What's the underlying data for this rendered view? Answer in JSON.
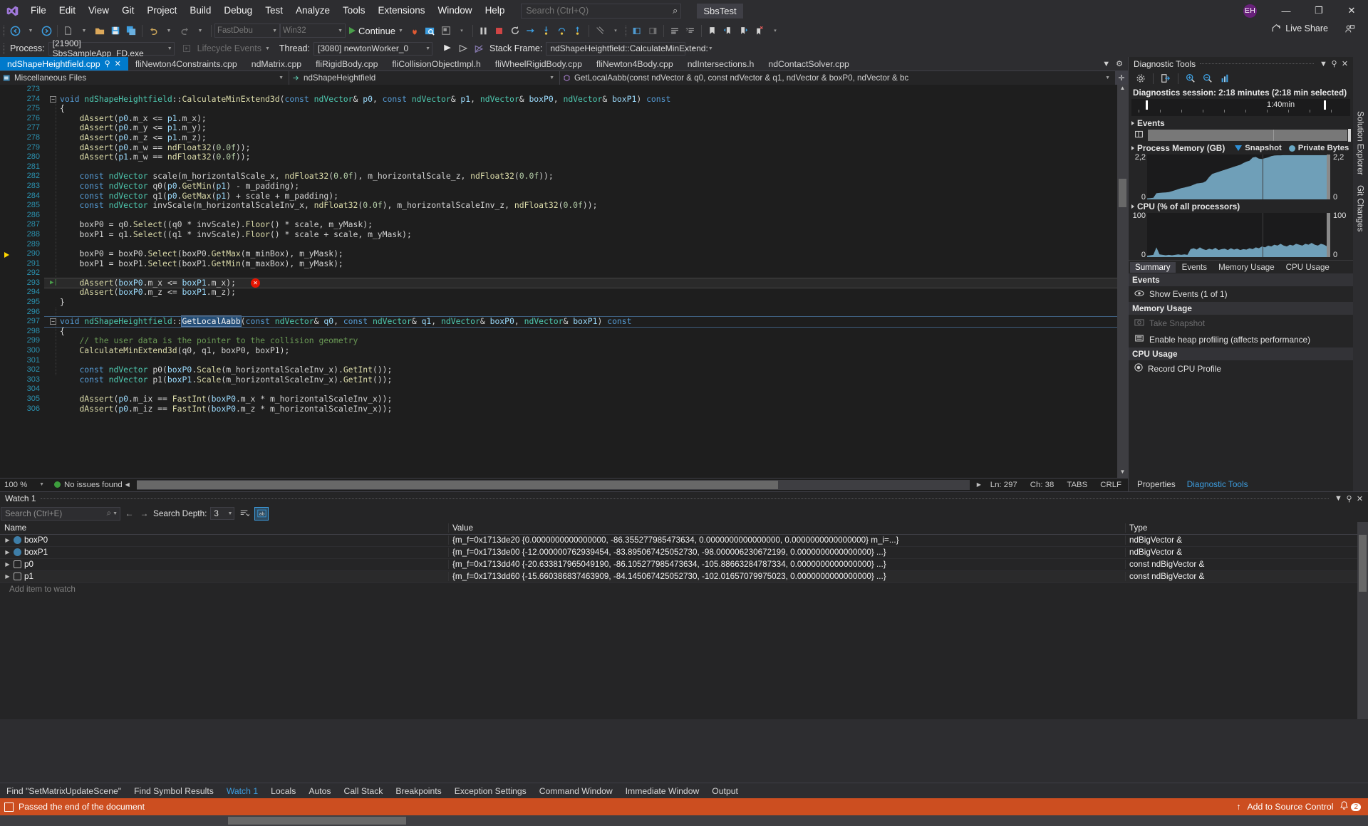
{
  "window": {
    "solution_name": "SbsTest",
    "avatar_initials": "EH",
    "minimize": "—",
    "maximize": "❐",
    "close": "✕"
  },
  "menu": {
    "items": [
      "File",
      "Edit",
      "View",
      "Git",
      "Project",
      "Build",
      "Debug",
      "Test",
      "Analyze",
      "Tools",
      "Extensions",
      "Window",
      "Help"
    ]
  },
  "search": {
    "placeholder": "Search (Ctrl+Q)",
    "icon": "search-icon"
  },
  "toolbar": {
    "config": "FastDebu",
    "platform": "Win32",
    "continue_label": "Continue",
    "live_share_label": "Live Share"
  },
  "debugbar": {
    "process_label": "Process:",
    "process_value": "[21900] SbsSampleApp_FD.exe",
    "lifecycle_label": "Lifecycle Events",
    "thread_label": "Thread:",
    "thread_value": "[3080] newtonWorker_0",
    "stackframe_label": "Stack Frame:",
    "stackframe_value": "ndShapeHeightfield::CalculateMinExtend:"
  },
  "tabs": {
    "items": [
      {
        "label": "ndShapeHeightfield.cpp",
        "active": true
      },
      {
        "label": "fliNewton4Constraints.cpp",
        "active": false
      },
      {
        "label": "ndMatrix.cpp",
        "active": false
      },
      {
        "label": "fliRigidBody.cpp",
        "active": false
      },
      {
        "label": "fliCollisionObjectImpl.h",
        "active": false
      },
      {
        "label": "fliWheelRigidBody.cpp",
        "active": false
      },
      {
        "label": "fliNewton4Body.cpp",
        "active": false
      },
      {
        "label": "ndIntersections.h",
        "active": false
      },
      {
        "label": "ndContactSolver.cpp",
        "active": false
      }
    ]
  },
  "breadcrumb": {
    "project": "Miscellaneous Files",
    "type": "ndShapeHeightfield",
    "member": "GetLocalAabb(const ndVector & q0, const ndVector & q1, ndVector & boxP0, ndVector & bc"
  },
  "editor": {
    "first_line": 273,
    "lines": [
      {
        "n": 273,
        "html": ""
      },
      {
        "n": 274,
        "html": "<span class='k'>void</span> <span class='t'>ndShapeHeightfield</span><span class='p'>::</span><span class='f'>CalculateMinExtend3d</span><span class='p'>(</span><span class='k'>const</span> <span class='t'>ndVector</span><span class='p'>&amp;</span> <span class='v'>p0</span><span class='p'>,</span> <span class='k'>const</span> <span class='t'>ndVector</span><span class='p'>&amp;</span> <span class='v'>p1</span><span class='p'>,</span> <span class='t'>ndVector</span><span class='p'>&amp;</span> <span class='v'>boxP0</span><span class='p'>,</span> <span class='t'>ndVector</span><span class='p'>&amp;</span> <span class='v'>boxP1</span><span class='p'>)</span> <span class='k'>const</span>",
        "fold": true
      },
      {
        "n": 275,
        "html": "<span class='p'>{</span>"
      },
      {
        "n": 276,
        "html": "    <span class='f'>dAssert</span><span class='p'>(</span><span class='v'>p0</span><span class='p'>.</span><span class='p'>m_x</span> <span class='p'>&lt;=</span> <span class='v'>p1</span><span class='p'>.</span><span class='p'>m_x</span><span class='p'>);</span>"
      },
      {
        "n": 277,
        "html": "    <span class='f'>dAssert</span><span class='p'>(</span><span class='v'>p0</span><span class='p'>.</span><span class='p'>m_y</span> <span class='p'>&lt;=</span> <span class='v'>p1</span><span class='p'>.</span><span class='p'>m_y</span><span class='p'>);</span>"
      },
      {
        "n": 278,
        "html": "    <span class='f'>dAssert</span><span class='p'>(</span><span class='v'>p0</span><span class='p'>.</span><span class='p'>m_z</span> <span class='p'>&lt;=</span> <span class='v'>p1</span><span class='p'>.</span><span class='p'>m_z</span><span class='p'>);</span>"
      },
      {
        "n": 279,
        "html": "    <span class='f'>dAssert</span><span class='p'>(</span><span class='v'>p0</span><span class='p'>.</span><span class='p'>m_w</span> <span class='p'>==</span> <span class='f'>ndFloat32</span><span class='p'>(</span><span class='n'>0.0f</span><span class='p'>));</span>"
      },
      {
        "n": 280,
        "html": "    <span class='f'>dAssert</span><span class='p'>(</span><span class='v'>p1</span><span class='p'>.</span><span class='p'>m_w</span> <span class='p'>==</span> <span class='f'>ndFloat32</span><span class='p'>(</span><span class='n'>0.0f</span><span class='p'>));</span>"
      },
      {
        "n": 281,
        "html": ""
      },
      {
        "n": 282,
        "html": "    <span class='k'>const</span> <span class='t'>ndVector</span> <span class='p'>scale(</span><span class='p'>m_horizontalScale_x</span><span class='p'>,</span> <span class='f'>ndFloat32</span><span class='p'>(</span><span class='n'>0.0f</span><span class='p'>),</span> <span class='p'>m_horizontalScale_z</span><span class='p'>,</span> <span class='f'>ndFloat32</span><span class='p'>(</span><span class='n'>0.0f</span><span class='p'>));</span>"
      },
      {
        "n": 283,
        "html": "    <span class='k'>const</span> <span class='t'>ndVector</span> <span class='p'>q0(</span><span class='v'>p0</span><span class='p'>.</span><span class='f'>GetMin</span><span class='p'>(</span><span class='v'>p1</span><span class='p'>)</span> <span class='p'>-</span> <span class='p'>m_padding);</span>"
      },
      {
        "n": 284,
        "html": "    <span class='k'>const</span> <span class='t'>ndVector</span> <span class='p'>q1(</span><span class='v'>p0</span><span class='p'>.</span><span class='f'>GetMax</span><span class='p'>(</span><span class='v'>p1</span><span class='p'>)</span> <span class='p'>+</span> <span class='p'>scale</span> <span class='p'>+</span> <span class='p'>m_padding);</span>"
      },
      {
        "n": 285,
        "html": "    <span class='k'>const</span> <span class='t'>ndVector</span> <span class='p'>invScale(</span><span class='p'>m_horizontalScaleInv_x</span><span class='p'>,</span> <span class='f'>ndFloat32</span><span class='p'>(</span><span class='n'>0.0f</span><span class='p'>),</span> <span class='p'>m_horizontalScaleInv_z</span><span class='p'>,</span> <span class='f'>ndFloat32</span><span class='p'>(</span><span class='n'>0.0f</span><span class='p'>));</span>"
      },
      {
        "n": 286,
        "html": ""
      },
      {
        "n": 287,
        "html": "    <span class='p'>boxP0 = q0.</span><span class='f'>Select</span><span class='p'>((q0 * invScale).</span><span class='f'>Floor</span><span class='p'>() * scale, m_yMask);</span>"
      },
      {
        "n": 288,
        "html": "    <span class='p'>boxP1 = q1.</span><span class='f'>Select</span><span class='p'>((q1 * invScale).</span><span class='f'>Floor</span><span class='p'>() * scale + scale, m_yMask);</span>"
      },
      {
        "n": 289,
        "html": ""
      },
      {
        "n": 290,
        "html": "    <span class='p'>boxP0 = boxP0.</span><span class='f'>Select</span><span class='p'>(boxP0.</span><span class='f'>GetMax</span><span class='p'>(m_minBox), m_yMask);</span>"
      },
      {
        "n": 291,
        "html": "    <span class='p'>boxP1 = boxP1.</span><span class='f'>Select</span><span class='p'>(boxP1.</span><span class='f'>GetMin</span><span class='p'>(m_maxBox), m_yMask);</span>"
      },
      {
        "n": 292,
        "html": ""
      },
      {
        "n": 293,
        "html": "    <span class='f'>dAssert</span><span class='p'>(</span><span class='v'>boxP0</span><span class='p'>.m_x &lt;= </span><span class='v'>boxP1</span><span class='p'>.m_x);</span>",
        "current": true,
        "error": true
      },
      {
        "n": 294,
        "html": "    <span class='f'>dAssert</span><span class='p'>(</span><span class='v'>boxP0</span><span class='p'>.m_z &lt;= </span><span class='v'>boxP1</span><span class='p'>.m_z);</span>"
      },
      {
        "n": 295,
        "html": "<span class='p'>}</span>"
      },
      {
        "n": 296,
        "html": ""
      },
      {
        "n": 297,
        "html": "<span class='k'>void</span> <span class='t'>ndShapeHeightfield</span><span class='p'>::</span><span class='sel'>GetLocalAabb</span><span class='p'>(</span><span class='k'>const</span> <span class='t'>ndVector</span><span class='p'>&amp;</span> <span class='v'>q0</span><span class='p'>,</span> <span class='k'>const</span> <span class='t'>ndVector</span><span class='p'>&amp;</span> <span class='v'>q1</span><span class='p'>,</span> <span class='t'>ndVector</span><span class='p'>&amp;</span> <span class='v'>boxP0</span><span class='p'>,</span> <span class='t'>ndVector</span><span class='p'>&amp;</span> <span class='v'>boxP1</span><span class='p'>)</span> <span class='k'>const</span>",
        "fold": true,
        "highlight": true
      },
      {
        "n": 298,
        "html": "<span class='p'>{</span>"
      },
      {
        "n": 299,
        "html": "    <span class='c'>// the user data is the pointer to the collision geometry</span>"
      },
      {
        "n": 300,
        "html": "    <span class='f'>CalculateMinExtend3d</span><span class='p'>(q0, q1, boxP0, boxP1);</span>"
      },
      {
        "n": 301,
        "html": ""
      },
      {
        "n": 302,
        "html": "    <span class='k'>const</span> <span class='t'>ndVector</span> <span class='p'>p0(</span><span class='v'>boxP0</span><span class='p'>.</span><span class='f'>Scale</span><span class='p'>(m_horizontalScaleInv_x).</span><span class='f'>GetInt</span><span class='p'>());</span>"
      },
      {
        "n": 303,
        "html": "    <span class='k'>const</span> <span class='t'>ndVector</span> <span class='p'>p1(</span><span class='v'>boxP1</span><span class='p'>.</span><span class='f'>Scale</span><span class='p'>(m_horizontalScaleInv_x).</span><span class='f'>GetInt</span><span class='p'>());</span>"
      },
      {
        "n": 304,
        "html": ""
      },
      {
        "n": 305,
        "html": "    <span class='f'>dAssert</span><span class='p'>(</span><span class='v'>p0</span><span class='p'>.m_ix == </span><span class='f'>FastInt</span><span class='p'>(</span><span class='v'>boxP0</span><span class='p'>.m_x * m_horizontalScaleInv_x));</span>"
      },
      {
        "n": 306,
        "html": "    <span class='f'>dAssert</span><span class='p'>(</span><span class='v'>p0</span><span class='p'>.m_iz == </span><span class='f'>FastInt</span><span class='p'>(</span><span class='v'>boxP0</span><span class='p'>.m_z * m_horizontalScaleInv_x));</span>"
      }
    ]
  },
  "editor_status": {
    "zoom": "100 %",
    "issues": "No issues found",
    "line": "Ln: 297",
    "col": "Ch: 38",
    "tabs": "TABS",
    "eol": "CRLF"
  },
  "diagnostics": {
    "title": "Diagnostic Tools",
    "session": "Diagnostics session: 2:18 minutes (2:18 min selected)",
    "timeline_label": "1:40min",
    "events_label": "Events",
    "memory_label": "Process Memory (GB)",
    "legend_snapshot": "Snapshot",
    "legend_private": "Private Bytes",
    "memory_max": "2,2",
    "memory_min": "0",
    "cpu_label": "CPU (% of all processors)",
    "cpu_max": "100",
    "cpu_min": "0",
    "tabs": [
      "Summary",
      "Events",
      "Memory Usage",
      "CPU Usage"
    ],
    "active_tab": "Summary",
    "summary": {
      "events_header": "Events",
      "show_events": "Show Events (1 of 1)",
      "memory_header": "Memory Usage",
      "take_snapshot": "Take Snapshot",
      "enable_heap": "Enable heap profiling (affects performance)",
      "cpu_header": "CPU Usage",
      "record_cpu": "Record CPU Profile"
    },
    "bottom_tabs": [
      "Properties",
      "Diagnostic Tools"
    ],
    "bottom_active": "Diagnostic Tools"
  },
  "right_dock": {
    "items": [
      "Solution Explorer",
      "Git Changes"
    ]
  },
  "watch": {
    "title": "Watch 1",
    "search_placeholder": "Search (Ctrl+E)",
    "depth_label": "Search Depth:",
    "depth_value": "3",
    "columns": [
      "Name",
      "Value",
      "Type"
    ],
    "rows": [
      {
        "name": "boxP0",
        "value": "{m_f=0x1713de20 {0.0000000000000000, -86.355277985473634, 0.0000000000000000, 0.0000000000000000} m_i=...}",
        "type": "ndBigVector &",
        "icon": "union-icon"
      },
      {
        "name": "boxP1",
        "value": "{m_f=0x1713de00 {-12.000000762939454, -83.895067425052730, -98.000006230672199, 0.0000000000000000} ...}",
        "type": "ndBigVector &",
        "icon": "union-icon"
      },
      {
        "name": "p0",
        "value": "{m_f=0x1713dd40 {-20.633817965049190, -86.105277985473634, -105.88663284787334, 0.0000000000000000} ...}",
        "type": "const ndBigVector &",
        "icon": "struct-icon"
      },
      {
        "name": "p1",
        "value": "{m_f=0x1713dd60 {-15.660386837463909, -84.145067425052730, -102.01657079975023, 0.0000000000000000} ...}",
        "type": "const ndBigVector &",
        "icon": "struct-icon"
      }
    ],
    "add_item": "Add item to watch"
  },
  "bottom_tabs": {
    "items": [
      "Find \"SetMatrixUpdateScene\"",
      "Find Symbol Results",
      "Watch 1",
      "Locals",
      "Autos",
      "Call Stack",
      "Breakpoints",
      "Exception Settings",
      "Command Window",
      "Immediate Window",
      "Output"
    ],
    "active": "Watch 1"
  },
  "statusbar": {
    "message": "Passed the end of the document",
    "source_control": "Add to Source Control",
    "notification_count": "2"
  },
  "chart_data": [
    {
      "type": "area",
      "title": "Process Memory (GB)",
      "ylim": [
        0,
        2.2
      ],
      "ylabel": "GB",
      "ytick_labels": [
        "2,2",
        "0"
      ],
      "values": [
        0.05,
        0.06,
        0.08,
        0.3,
        0.32,
        0.33,
        0.34,
        0.36,
        0.4,
        0.45,
        0.5,
        0.55,
        0.58,
        0.62,
        0.66,
        0.72,
        0.78,
        0.8,
        0.82,
        0.9,
        1.1,
        1.25,
        1.3,
        1.35,
        1.4,
        1.45,
        1.5,
        1.55,
        1.6,
        1.65,
        1.7,
        1.78,
        1.85,
        1.9,
        2.05,
        2.08,
        2.0,
        1.98,
        2.02,
        2.06,
        2.12,
        2.15,
        2.16,
        2.16,
        2.17,
        2.17,
        2.17,
        2.17,
        2.17,
        2.17,
        2.17,
        2.17,
        2.17,
        2.17,
        2.17,
        2.17,
        2.17,
        2.17,
        2.17,
        2.17
      ],
      "legend": [
        "Snapshot",
        "Private Bytes"
      ],
      "legend_position": "top-right",
      "grid": false,
      "color": "#6f9fb8"
    },
    {
      "type": "area",
      "title": "CPU (% of all processors)",
      "ylim": [
        0,
        100
      ],
      "ylabel": "%",
      "ytick_labels": [
        "100",
        "0"
      ],
      "values": [
        3,
        4,
        5,
        22,
        6,
        5,
        4,
        5,
        4,
        5,
        6,
        5,
        6,
        5,
        18,
        20,
        17,
        22,
        18,
        16,
        19,
        17,
        21,
        16,
        18,
        19,
        16,
        20,
        17,
        19,
        16,
        18,
        17,
        20,
        18,
        22,
        20,
        24,
        22,
        26,
        24,
        28,
        26,
        30,
        26,
        24,
        28,
        26,
        30,
        28,
        26,
        30,
        28,
        32,
        28,
        26,
        30,
        28,
        24,
        6
      ],
      "grid": false,
      "color": "#6f9fb8"
    }
  ]
}
